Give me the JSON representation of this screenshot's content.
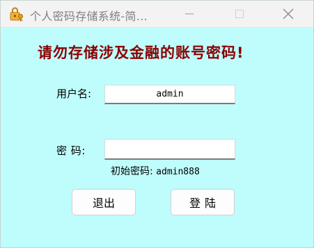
{
  "window": {
    "title": "个人密码存储系统-简...",
    "icon": "lock-key-icon",
    "controls": [
      "minimize-icon",
      "maximize-icon",
      "close-icon"
    ]
  },
  "form": {
    "warning": "请勿存储涉及金融的账号密码!",
    "username_label": "用户名:",
    "username_value": "admin",
    "password_label": "密 码:",
    "password_value": "",
    "hint_prefix": "初始密码:",
    "hint_value": "admin888",
    "exit_label": "退出",
    "login_label": "登陆"
  },
  "colors": {
    "background": "#bffcfc",
    "warning_text": "#8b0000",
    "titlebar": "#f3f3f3"
  }
}
